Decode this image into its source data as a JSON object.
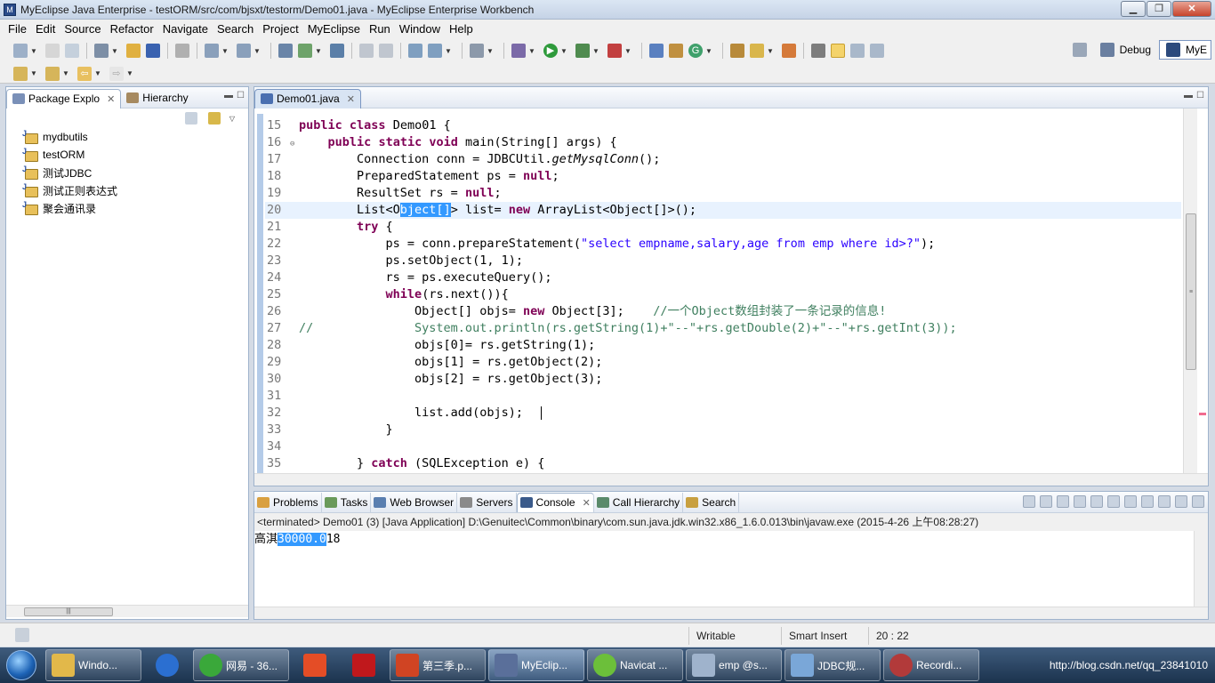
{
  "window": {
    "title": "MyEclipse Java Enterprise - testORM/src/com/bjsxt/testorm/Demo01.java - MyEclipse Enterprise Workbench"
  },
  "menu": [
    "File",
    "Edit",
    "Source",
    "Refactor",
    "Navigate",
    "Search",
    "Project",
    "MyEclipse",
    "Run",
    "Window",
    "Help"
  ],
  "perspectives": {
    "debug": "Debug",
    "myeclipse": "MyE"
  },
  "package_explorer": {
    "tab_label": "Package Explo",
    "hierarchy_label": "Hierarchy",
    "projects": [
      "mydbutils",
      "testORM",
      "测试JDBC",
      "测试正则表达式",
      "聚会通讯录"
    ]
  },
  "editor": {
    "tab_label": "Demo01.java",
    "lines": [
      {
        "n": "15",
        "text": ""
      },
      {
        "n": "16",
        "text": ""
      },
      {
        "n": "17",
        "text": ""
      },
      {
        "n": "18",
        "text": ""
      },
      {
        "n": "19",
        "text": ""
      },
      {
        "n": "20",
        "text": ""
      },
      {
        "n": "21",
        "text": ""
      },
      {
        "n": "22",
        "text": ""
      },
      {
        "n": "23",
        "text": ""
      },
      {
        "n": "24",
        "text": ""
      },
      {
        "n": "25",
        "text": ""
      },
      {
        "n": "26",
        "text": ""
      },
      {
        "n": "27",
        "text": ""
      },
      {
        "n": "28",
        "text": ""
      },
      {
        "n": "29",
        "text": ""
      },
      {
        "n": "30",
        "text": ""
      },
      {
        "n": "31",
        "text": ""
      },
      {
        "n": "32",
        "text": ""
      },
      {
        "n": "33",
        "text": ""
      },
      {
        "n": "34",
        "text": ""
      },
      {
        "n": "35",
        "text": ""
      }
    ]
  },
  "bottom_tabs": [
    "Problems",
    "Tasks",
    "Web Browser",
    "Servers",
    "Console",
    "Call Hierarchy",
    "Search"
  ],
  "console": {
    "header": "<terminated> Demo01 (3) [Java Application] D:\\Genuitec\\Common\\binary\\com.sun.java.jdk.win32.x86_1.6.0.013\\bin\\javaw.exe (2015-4-26 上午08:28:27)",
    "output_prefix": "高淇",
    "output_selected": "30000.0",
    "output_suffix": "18"
  },
  "statusbar": {
    "writable": "Writable",
    "insert_mode": "Smart Insert",
    "position": "20 : 22"
  },
  "taskbar": {
    "tasks": [
      {
        "label": "Windo...",
        "color": "#e2b84a"
      },
      {
        "label": "",
        "color": "#2b6fd1"
      },
      {
        "label": "网易 - 36...",
        "color": "#3aa83a"
      },
      {
        "label": "",
        "color": "#e44d26"
      },
      {
        "label": "",
        "color": "#c0181c"
      },
      {
        "label": "第三季.p...",
        "color": "#d04423"
      },
      {
        "label": "MyEclip...",
        "color": "#5a6f9a"
      },
      {
        "label": "Navicat ...",
        "color": "#6cbf3a"
      },
      {
        "label": "emp @s...",
        "color": "#9fb3cc"
      },
      {
        "label": "JDBC规...",
        "color": "#7aa7d8"
      },
      {
        "label": "Recordi...",
        "color": "#b23a3a"
      }
    ],
    "tray_text": "http://blog.csdn.net/qq_23841010"
  },
  "colors": {
    "keyword": "#7f0055",
    "string": "#2a00ff",
    "comment": "#3f7f5f",
    "selection": "#3399ff"
  }
}
